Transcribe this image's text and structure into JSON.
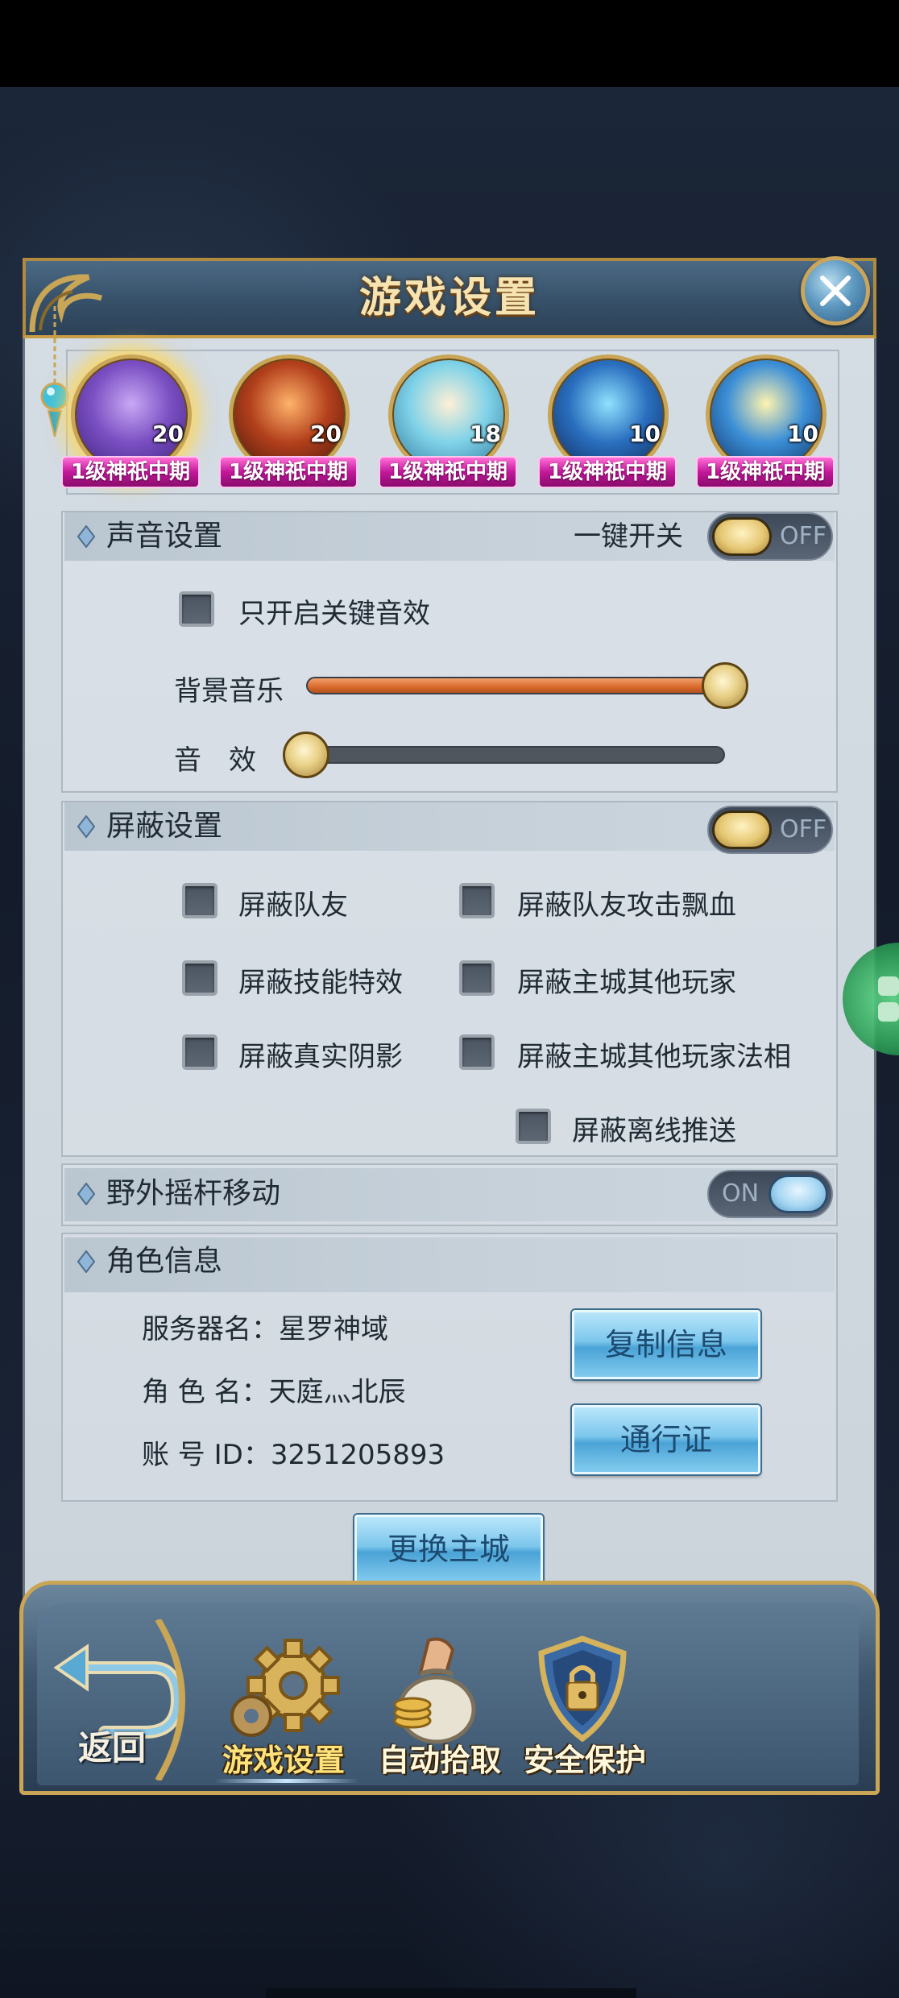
{
  "dialog": {
    "title": "游戏设置"
  },
  "avatars": [
    {
      "level": "20",
      "tag": "1级神祇中期",
      "active": true
    },
    {
      "level": "20",
      "tag": "1级神祇中期",
      "active": false
    },
    {
      "level": "18",
      "tag": "1级神祇中期",
      "active": false
    },
    {
      "level": "10",
      "tag": "1级神祇中期",
      "active": false
    },
    {
      "level": "10",
      "tag": "1级神祇中期",
      "active": false
    }
  ],
  "sound": {
    "title": "声音设置",
    "master_label": "一键开关",
    "master_state": "OFF",
    "key_only_label": "只开启关键音效",
    "key_only_checked": false,
    "bgm_label": "背景音乐",
    "bgm_level": 1.0,
    "sfx_label": "音　效",
    "sfx_level": 0.0
  },
  "block": {
    "title": "屏蔽设置",
    "state": "OFF",
    "options": [
      {
        "label": "屏蔽队友",
        "checked": false
      },
      {
        "label": "屏蔽队友攻击飘血",
        "checked": false
      },
      {
        "label": "屏蔽技能特效",
        "checked": false
      },
      {
        "label": "屏蔽主城其他玩家",
        "checked": false
      },
      {
        "label": "屏蔽真实阴影",
        "checked": false
      },
      {
        "label": "屏蔽主城其他玩家法相",
        "checked": false
      },
      {
        "label": "屏蔽离线推送",
        "checked": false
      }
    ]
  },
  "joystick": {
    "title": "野外摇杆移动",
    "state": "ON"
  },
  "role": {
    "title": "角色信息",
    "server": "服务器名：星罗神域",
    "name": "角 色 名：天庭灬北辰",
    "account": "账 号 ID：3251205893",
    "copy_button": "复制信息",
    "pass_button": "通行证"
  },
  "change_city_button": "更换主城",
  "nav": {
    "back": "返回",
    "tabs": [
      {
        "label": "游戏设置",
        "icon": "gear-icon",
        "active": true
      },
      {
        "label": "自动拾取",
        "icon": "money-bag-icon",
        "active": false
      },
      {
        "label": "安全保护",
        "icon": "shield-lock-icon",
        "active": false
      }
    ]
  },
  "colors": {
    "accent_gold": "#c9a556",
    "tag_pink": "#c2189a",
    "slider_orange": "#d96a2c",
    "button_blue": "#7cc6ec"
  }
}
